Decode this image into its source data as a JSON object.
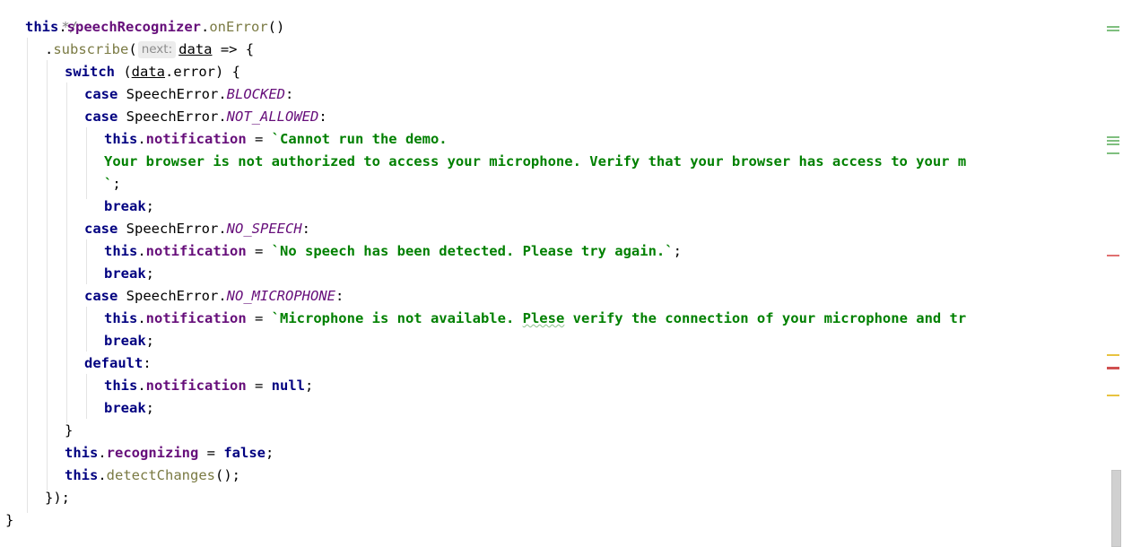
{
  "code": {
    "comment_end": "*/",
    "this": "this",
    "speechRecognizer": "speechRecognizer",
    "onError": "onError",
    "subscribe": "subscribe",
    "hint_next": "next:",
    "data": "data",
    "error": "error",
    "switch": "switch",
    "case": "case",
    "SpeechError": "SpeechError",
    "BLOCKED": "BLOCKED",
    "NOT_ALLOWED": "NOT_ALLOWED",
    "NO_SPEECH": "NO_SPEECH",
    "NO_MICROPHONE": "NO_MICROPHONE",
    "notification": "notification",
    "recognizing": "recognizing",
    "detectChanges": "detectChanges",
    "break": "break",
    "default": "default",
    "null": "null",
    "false": "false",
    "str_cannot_run": "`Cannot run the demo.",
    "str_not_authorized": "Your browser is not authorized to access your microphone. Verify that your browser has access to your m",
    "str_backtick_close": "`",
    "str_no_speech": "`No speech has been detected. Please try again.`",
    "str_mic_prefix": "`Microphone is not available. ",
    "str_mic_typo": "Plese",
    "str_mic_suffix": " verify the connection of your microphone and tr"
  },
  "gutter_marks": [
    {
      "color": "#7fbf7f",
      "kind": "change"
    },
    {
      "color": "#7fbf7f",
      "kind": "change"
    },
    {
      "color": "#7fbf7f",
      "kind": "change"
    },
    {
      "color": "#e07070",
      "kind": "error"
    },
    {
      "color": "#e8c340",
      "kind": "warning"
    },
    {
      "color": "#d05050",
      "kind": "error"
    },
    {
      "color": "#e8c340",
      "kind": "warning"
    }
  ]
}
